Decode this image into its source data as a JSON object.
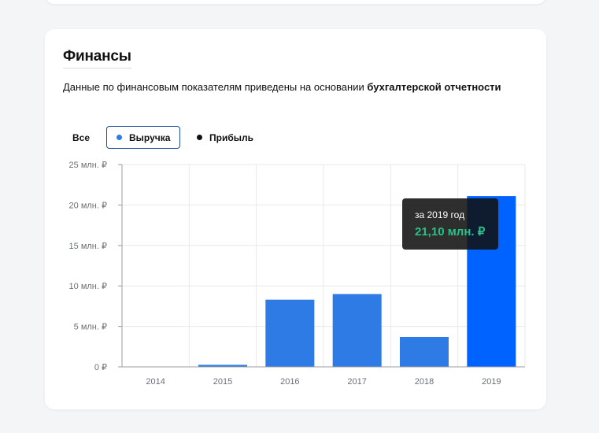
{
  "section": {
    "title": "Финансы",
    "description_prefix": "Данные по финансовым показателям приведены на основании ",
    "description_bold": "бухгалтерской отчетности"
  },
  "filters": [
    {
      "label": "Все",
      "active": false
    },
    {
      "label": "Выручка",
      "active": true,
      "dot_color": "#2f7be5"
    },
    {
      "label": "Прибыль",
      "active": false,
      "dot_color": "#111111"
    }
  ],
  "tooltip": {
    "period": "за 2019 год",
    "value": "21,10 млн. ₽"
  },
  "colors": {
    "bar": "#2f7be5",
    "bar_highlight": "#0062ff",
    "active_border": "#1c4f9c",
    "tooltip_value": "#29c18a"
  },
  "chart_data": {
    "type": "bar",
    "categories": [
      "2014",
      "2015",
      "2016",
      "2017",
      "2018",
      "2019"
    ],
    "series": [
      {
        "name": "Выручка",
        "values": [
          0,
          0.25,
          8.3,
          9.0,
          3.7,
          21.1
        ]
      }
    ],
    "highlighted_index": 5,
    "ylim": [
      0,
      25
    ],
    "yticks": [
      0,
      5,
      10,
      15,
      20,
      25
    ],
    "ytick_labels": [
      "0 ₽",
      "5 млн. ₽",
      "10 млн. ₽",
      "15 млн. ₽",
      "20 млн. ₽",
      "25 млн. ₽"
    ],
    "grid": true
  }
}
